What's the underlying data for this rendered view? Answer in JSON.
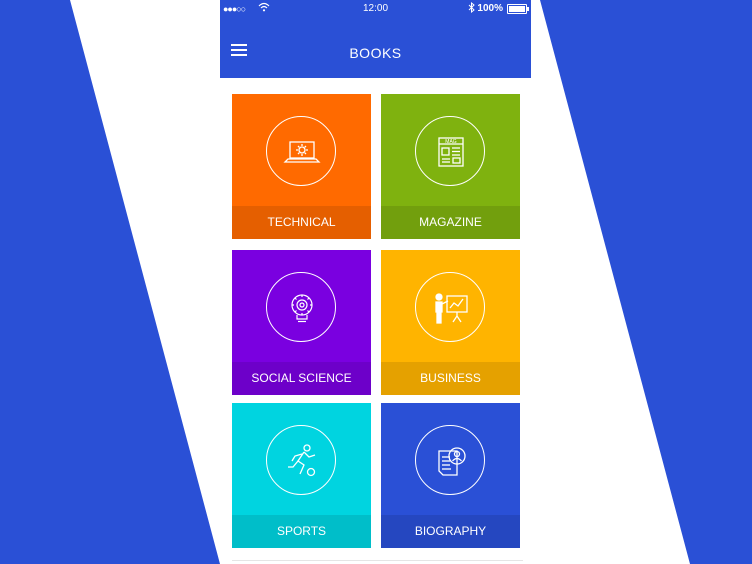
{
  "colors": {
    "brand_blue": "#2a50d6",
    "technical": "#ff6a00",
    "magazine": "#7fb20f",
    "social_science": "#7a00e0",
    "business": "#ffb400",
    "sports": "#00d4e0",
    "biography": "#2a50d6"
  },
  "status_bar": {
    "signal": "●●●○○",
    "time": "12:00",
    "battery": "100%"
  },
  "header": {
    "title": "BOOKS",
    "menu_icon": "hamburger-menu-icon"
  },
  "categories": [
    {
      "label": "TECHNICAL",
      "icon": "laptop-gear-icon"
    },
    {
      "label": "MAGAZINE",
      "icon": "newspaper-icon",
      "icon_text": "MAG"
    },
    {
      "label": "SOCIAL SCIENCE",
      "icon": "lightbulb-gear-icon"
    },
    {
      "label": "BUSINESS",
      "icon": "presentation-icon"
    },
    {
      "label": "SPORTS",
      "icon": "football-player-icon"
    },
    {
      "label": "BIOGRAPHY",
      "icon": "document-profile-icon"
    }
  ]
}
